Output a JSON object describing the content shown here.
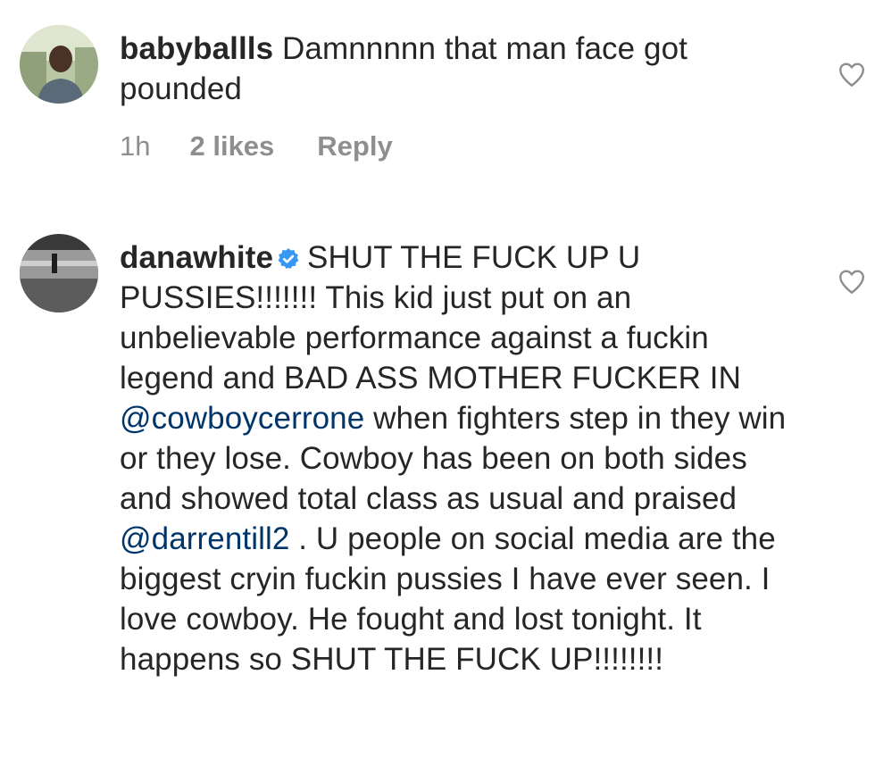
{
  "comments": [
    {
      "username": "babyballls",
      "text": "Damnnnnn that man face got pounded",
      "time": "1h",
      "likes": "2 likes",
      "reply": "Reply"
    },
    {
      "username": "danawhite",
      "text_1": "SHUT THE FUCK UP U PUSSIES!!!!!!! This kid just put on an unbelievable performance against a fuckin legend and BAD ASS MOTHER FUCKER IN ",
      "mention_1": "@cowboycerrone",
      "text_2": " when fighters step in they win or they lose. Cowboy has been on both sides and showed total class as usual and praised ",
      "mention_2": "@darrentill2",
      "text_3": " . U people on social media are the biggest cryin fuckin pussies I have ever seen. I love cowboy. He fought and lost tonight. It happens so SHUT THE FUCK UP!!!!!!!!"
    }
  ],
  "colors": {
    "text": "#262626",
    "muted": "#8e8e8e",
    "mention": "#003569",
    "verified": "#3897f0"
  },
  "icons": [
    "heart-outline-icon",
    "verified-badge-icon"
  ]
}
